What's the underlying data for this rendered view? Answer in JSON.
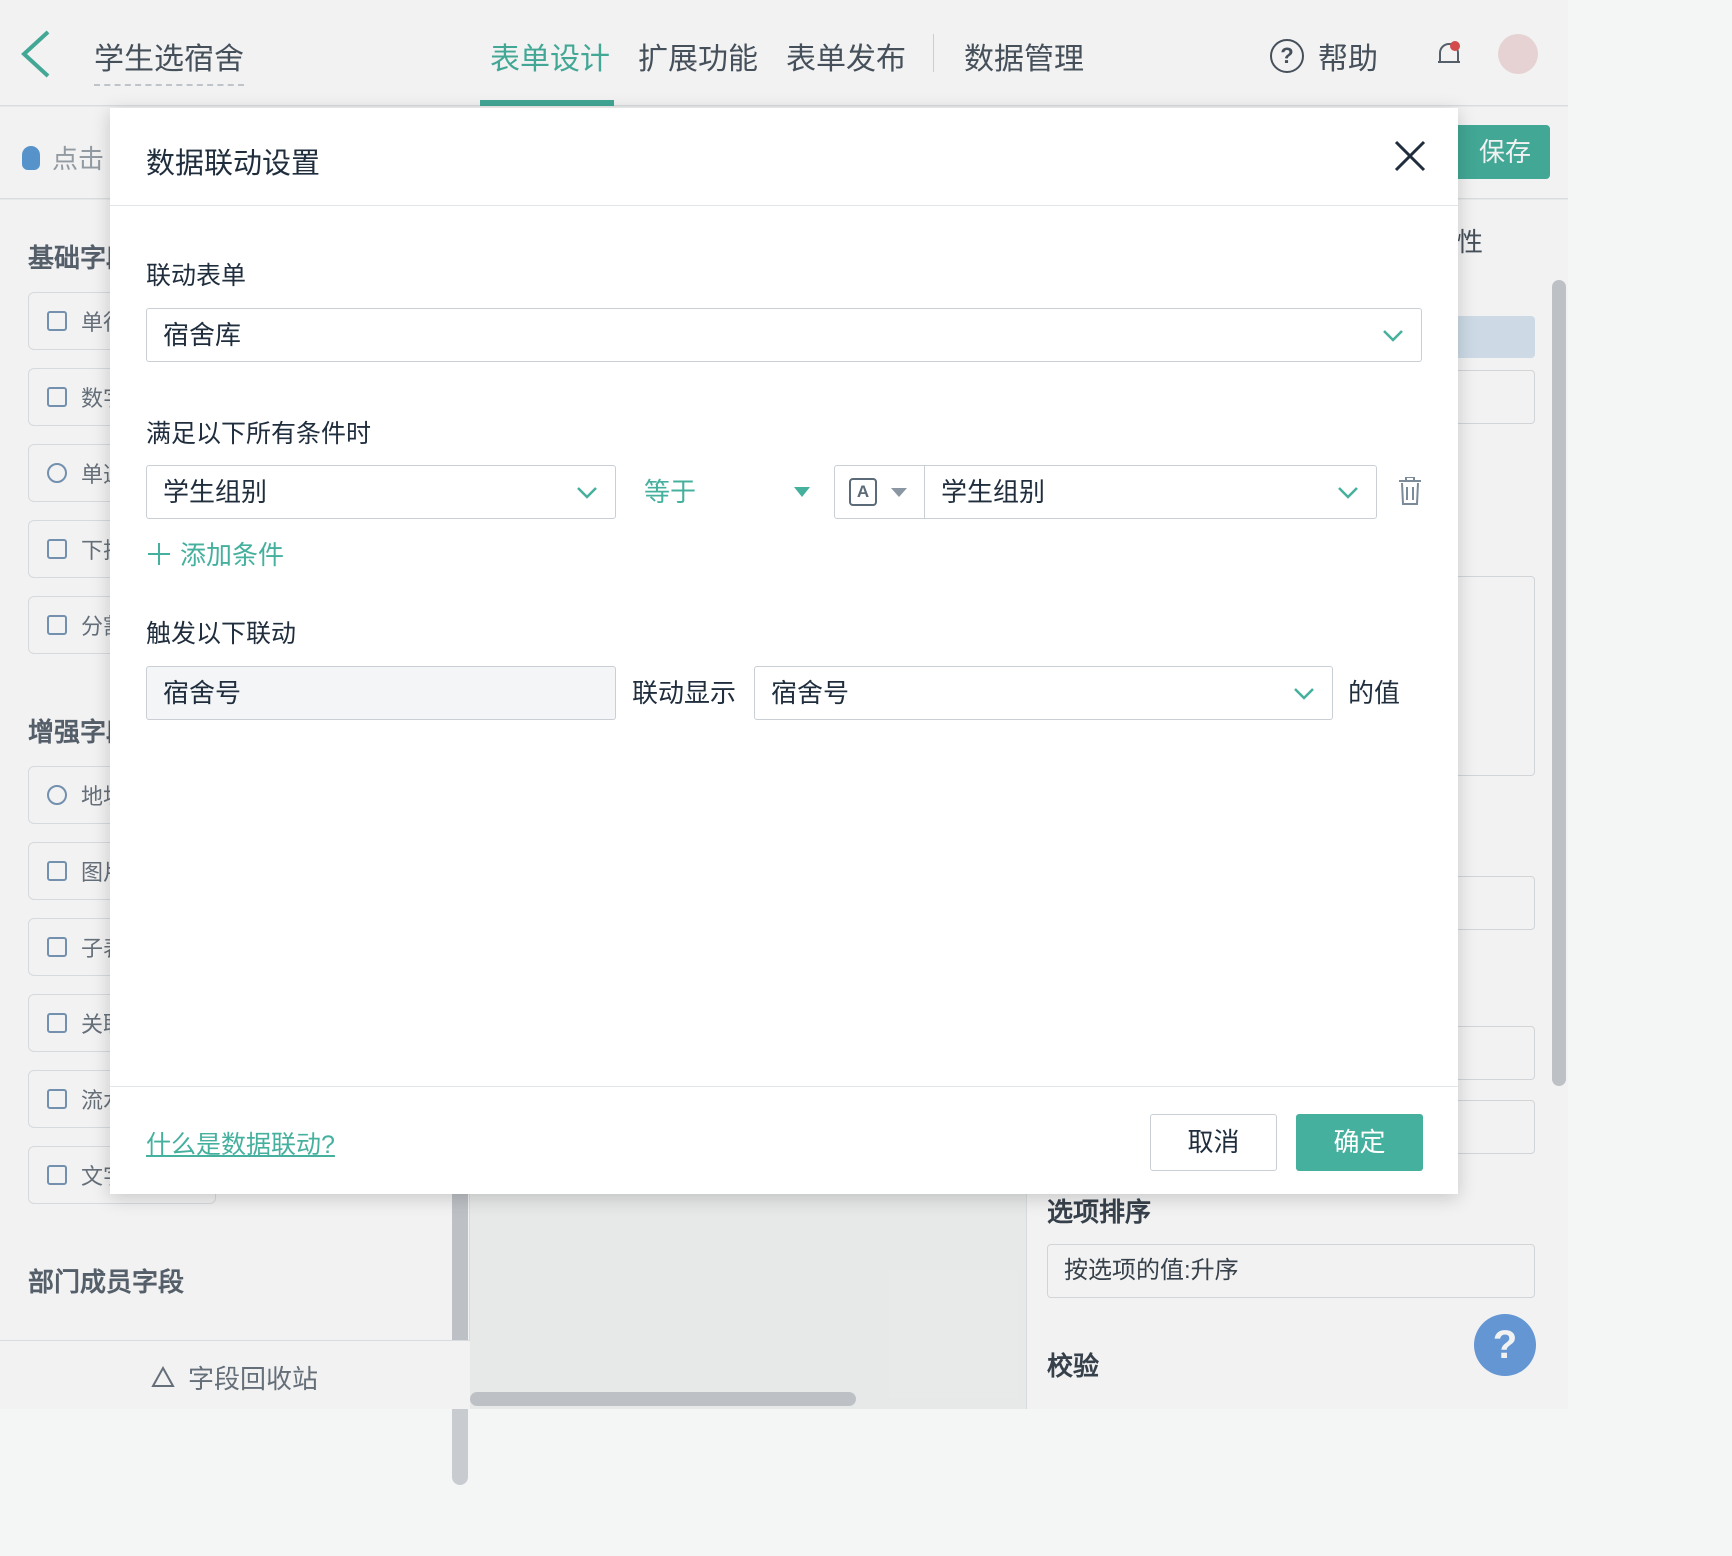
{
  "app": {
    "title": "学生选宿舍",
    "nav_tabs": [
      "表单设计",
      "扩展功能",
      "表单发布",
      "数据管理"
    ],
    "active_tab": "表单设计",
    "help_label": "帮助",
    "hint_text": "点击",
    "save_label": "保存",
    "recycle_label": "字段回收站"
  },
  "left_panel": {
    "sections": [
      "基础字段",
      "增强字段",
      "部门成员字段"
    ],
    "basic_fields": [
      "单行",
      "数字",
      "单选",
      "下拉",
      "分割"
    ],
    "enhanced_fields": [
      "地址",
      "图片",
      "子表",
      "关联",
      "流水",
      "文字"
    ]
  },
  "right_panel": {
    "tab_fragment": "性",
    "sort_label": "选项排序",
    "sort_value": "按选项的值:升序",
    "validate_label": "校验"
  },
  "modal": {
    "title": "数据联动设置",
    "linked_form_label": "联动表单",
    "linked_form_value": "宿舍库",
    "conditions_label": "满足以下所有条件时",
    "condition": {
      "field": "学生组别",
      "operator": "等于",
      "value_type_badge": "A",
      "value": "学生组别"
    },
    "add_condition_label": "添加条件",
    "trigger_label": "触发以下联动",
    "trigger": {
      "target_field": "宿舍号",
      "link_text": "联动显示",
      "source_field": "宿舍号",
      "suffix": "的值"
    },
    "help_link": "什么是数据联动?",
    "cancel_label": "取消",
    "confirm_label": "确定"
  },
  "colors": {
    "accent": "#46b09e",
    "text": "#1f2d3d",
    "border": "#c9cfd4"
  }
}
